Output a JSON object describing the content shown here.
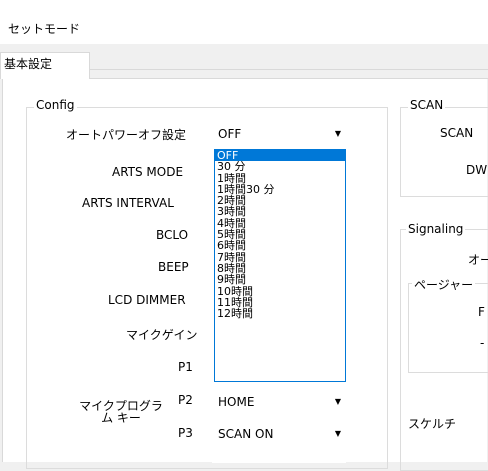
{
  "window": {
    "title": "セットモード"
  },
  "tabs": [
    {
      "label": "基本設定"
    }
  ],
  "config": {
    "legend": "Config",
    "labels": {
      "auto_power_off": "オートパワーオフ設定",
      "arts_mode": "ARTS MODE",
      "arts_interval": "ARTS INTERVAL",
      "bclo": "BCLO",
      "beep": "BEEP",
      "lcd_dimmer": "LCD DIMMER",
      "mic_gain": "マイクゲイン",
      "p1": "P1",
      "mic_program_key": "マイクプログラム キー",
      "p2": "P2",
      "p3": "P3"
    },
    "auto_power_off_value": "OFF",
    "p2_value": "HOME",
    "p3_value": "SCAN ON",
    "dropdown_options": [
      "OFF",
      "30 分",
      "1時間",
      "1時間30 分",
      "2時間",
      "3時間",
      "4時間",
      "5時間",
      "6時間",
      "7時間",
      "8時間",
      "9時間",
      "10時間",
      "11時間",
      "12時間"
    ],
    "dropdown_selected_index": 0
  },
  "scan": {
    "legend": "SCAN",
    "label1": "SCAN",
    "label2": "DW"
  },
  "signaling": {
    "legend": "Signaling",
    "label1": "オー",
    "pager_legend": "ページャー",
    "label2": "F",
    "label3": "-",
    "label4": "スケルチ"
  },
  "icons": {
    "combo_arrow": "chevron-down-icon"
  }
}
